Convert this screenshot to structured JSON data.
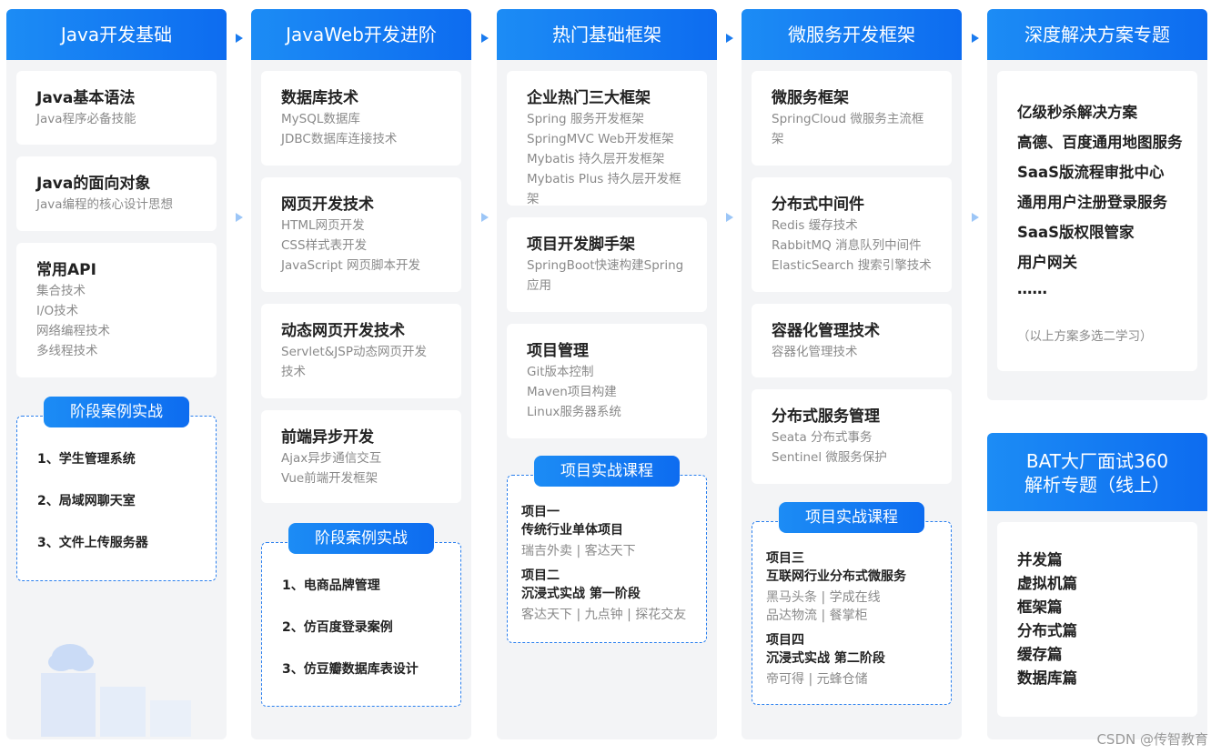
{
  "columns": [
    {
      "title": "Java开发基础",
      "cards": [
        {
          "title": "Java基本语法",
          "items": [
            "Java程序必备技能"
          ]
        },
        {
          "title": "Java的面向对象",
          "items": [
            "Java编程的核心设计思想"
          ]
        },
        {
          "title": "常用API",
          "items": [
            "集合技术",
            "I/O技术",
            "网络编程技术",
            "多线程技术"
          ]
        }
      ],
      "case": {
        "tag": "阶段案例实战",
        "items": [
          "1、学生管理系统",
          "2、局域网聊天室",
          "3、文件上传服务器"
        ]
      }
    },
    {
      "title": "JavaWeb开发进阶",
      "cards": [
        {
          "title": "数据库技术",
          "items": [
            "MySQL数据库",
            "JDBC数据库连接技术"
          ]
        },
        {
          "title": "网页开发技术",
          "items": [
            "HTML网页开发",
            "CSS样式表开发",
            "JavaScript 网页脚本开发"
          ]
        },
        {
          "title": "动态网页开发技术",
          "items": [
            "Servlet&JSP动态网页开发",
            "技术"
          ]
        },
        {
          "title": "前端异步开发",
          "items": [
            "Ajax异步通信交互",
            "Vue前端开发框架"
          ]
        }
      ],
      "case": {
        "tag": "阶段案例实战",
        "items": [
          "1、电商品牌管理",
          "2、仿百度登录案例",
          "3、仿豆瓣数据库表设计"
        ]
      }
    },
    {
      "title": "热门基础框架",
      "cards": [
        {
          "title": "企业热门三大框架",
          "items": [
            "Spring 服务开发框架",
            "SpringMVC Web开发框架",
            "Mybatis 持久层开发框架",
            "Mybatis Plus 持久层开发框架"
          ]
        },
        {
          "title": "项目开发脚手架",
          "items": [
            "SpringBoot快速构建Spring",
            "应用"
          ]
        },
        {
          "title": "项目管理",
          "items": [
            "Git版本控制",
            "Maven项目构建",
            "Linux服务器系统"
          ]
        }
      ],
      "projects": {
        "tag": "项目实战课程",
        "items": [
          {
            "l1": "项目一",
            "l2": "传统行业单体项目",
            "sub": [
              "瑞吉外卖 | 客达天下"
            ]
          },
          {
            "l1": "项目二",
            "l2": "沉浸式实战 第一阶段",
            "sub": [
              "客达天下 | 九点钟 | 探花交友"
            ]
          }
        ]
      }
    },
    {
      "title": "微服务开发框架",
      "cards": [
        {
          "title": "微服务框架",
          "items": [
            "SpringCloud 微服务主流框",
            "架"
          ]
        },
        {
          "title": "分布式中间件",
          "items": [
            "Redis 缓存技术",
            "RabbitMQ 消息队列中间件",
            "ElasticSearch 搜索引擎技术"
          ]
        },
        {
          "title": "容器化管理技术",
          "items": [
            "容器化管理技术"
          ]
        },
        {
          "title": "分布式服务管理",
          "items": [
            "Seata 分布式事务",
            "Sentinel 微服务保护"
          ]
        }
      ],
      "projects": {
        "tag": "项目实战课程",
        "items": [
          {
            "l1": "项目三",
            "l2": "互联网行业分布式微服务",
            "sub": [
              "黑马头条 | 学成在线",
              "品达物流 | 餐掌柜"
            ]
          },
          {
            "l1": "项目四",
            "l2": "沉浸式实战 第二阶段",
            "sub": [
              "帝可得 | 元蜂仓储"
            ]
          }
        ]
      }
    },
    {
      "title": "深度解决方案专题",
      "solutions": [
        "亿级秒杀解决方案",
        "高德、百度通用地图服务",
        "SaaS版流程审批中心",
        "通用用户注册登录服务",
        "SaaS版权限管家",
        "用户网关",
        "……"
      ],
      "solutions_note": "（以上方案多选二学习）",
      "interview_title_1": "BAT大厂面试360",
      "interview_title_2": "解析专题（线上）",
      "interview_items": [
        "并发篇",
        "虚拟机篇",
        "框架篇",
        "分布式篇",
        "缓存篇",
        "数据库篇"
      ]
    }
  ],
  "watermark": "CSDN @传智教育",
  "colors": {
    "accent": "#0d6cf0",
    "panel": "#f3f4f6",
    "muted": "#8a8a8a"
  }
}
